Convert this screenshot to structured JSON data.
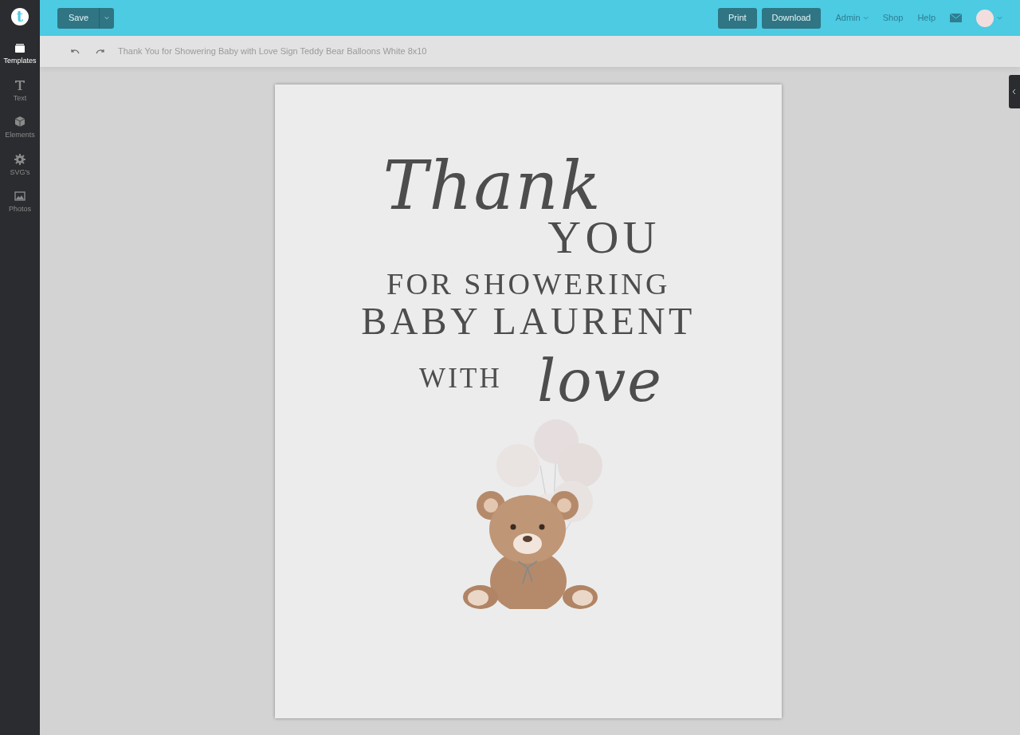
{
  "logo": {
    "letter": "t"
  },
  "sidebar": {
    "items": [
      {
        "label": "Templates",
        "selected": true
      },
      {
        "label": "Text",
        "selected": false
      },
      {
        "label": "Elements",
        "selected": false
      },
      {
        "label": "SVG's",
        "selected": false
      },
      {
        "label": "Photos",
        "selected": false
      }
    ]
  },
  "topbar": {
    "save": "Save",
    "actions": [
      "Print",
      "Download"
    ],
    "links": [
      {
        "label": "Admin",
        "dropdown": true
      },
      {
        "label": "Shop",
        "dropdown": false
      },
      {
        "label": "Help",
        "dropdown": false
      }
    ]
  },
  "toolbar": {
    "document_title": "Thank You for Showering Baby with Love Sign Teddy Bear Balloons White 8x10"
  },
  "canvas": {
    "lines": [
      {
        "kind": "script",
        "text": "Thank"
      },
      {
        "kind": "caps",
        "text": "YOU"
      },
      {
        "kind": "caps",
        "text": "FOR SHOWERING"
      },
      {
        "kind": "caps",
        "text": "BABY LAURENT"
      },
      {
        "kind": "caps",
        "text": "WITH"
      },
      {
        "kind": "script",
        "text": "love"
      }
    ]
  }
}
